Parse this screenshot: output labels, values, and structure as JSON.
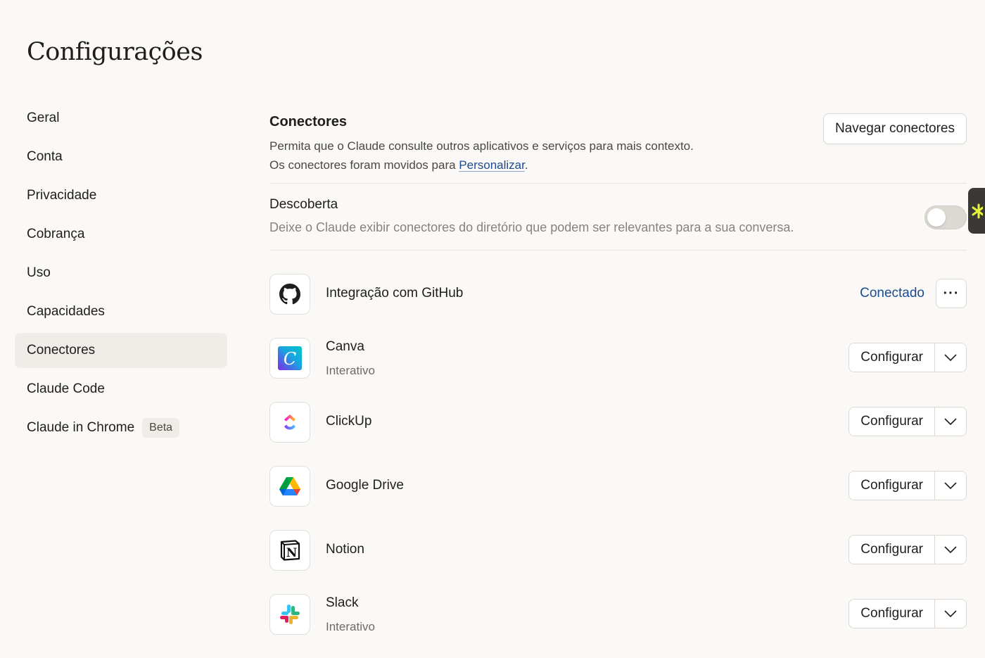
{
  "page": {
    "title": "Configurações"
  },
  "sidebar": {
    "items": [
      {
        "label": "Geral"
      },
      {
        "label": "Conta"
      },
      {
        "label": "Privacidade"
      },
      {
        "label": "Cobrança"
      },
      {
        "label": "Uso"
      },
      {
        "label": "Capacidades"
      },
      {
        "label": "Conectores",
        "active": true
      },
      {
        "label": "Claude Code"
      },
      {
        "label": "Claude in Chrome",
        "badge": "Beta"
      }
    ]
  },
  "connectors_section": {
    "title": "Conectores",
    "description_line1": "Permita que o Claude consulte outros aplicativos e serviços para mais contexto.",
    "description_line2_prefix": "Os conectores foram movidos para ",
    "description_link": "Personalizar",
    "description_line2_suffix": ".",
    "browse_button": "Navegar conectores"
  },
  "discovery": {
    "title": "Descoberta",
    "description": "Deixe o Claude exibir conectores do diretório que podem ser relevantes para a sua conversa.",
    "enabled": false
  },
  "connectors": [
    {
      "name": "Integração com GitHub",
      "icon": "github-icon",
      "status": "Conectado",
      "more": "···"
    },
    {
      "name": "Canva",
      "icon": "canva-icon",
      "subtitle": "Interativo",
      "action": "Configurar"
    },
    {
      "name": "ClickUp",
      "icon": "clickup-icon",
      "action": "Configurar"
    },
    {
      "name": "Google Drive",
      "icon": "google-drive-icon",
      "action": "Configurar"
    },
    {
      "name": "Notion",
      "icon": "notion-icon",
      "action": "Configurar"
    },
    {
      "name": "Slack",
      "icon": "slack-icon",
      "subtitle": "Interativo",
      "action": "Configurar"
    }
  ],
  "colors": {
    "background": "#faf9f7",
    "link": "#1c4b8f",
    "active_nav": "#efede8"
  }
}
